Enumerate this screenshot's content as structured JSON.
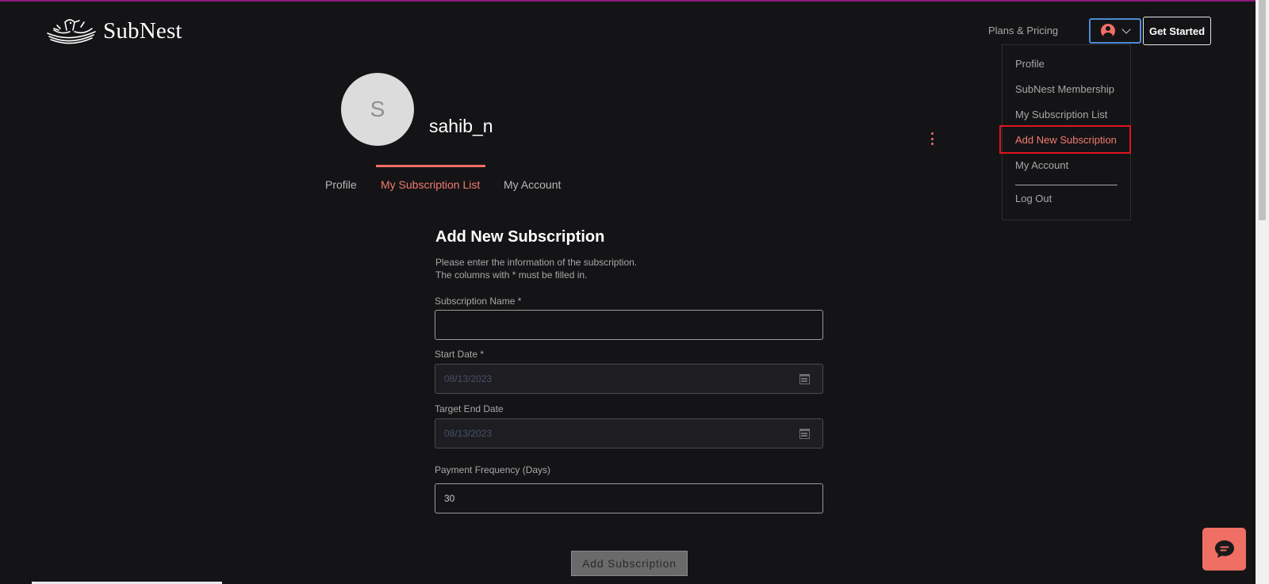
{
  "header": {
    "brand": "SubNest",
    "nav_plans": "Plans & Pricing",
    "get_started": "Get Started"
  },
  "user_menu": {
    "items": [
      {
        "label": "Profile"
      },
      {
        "label": "SubNest Membership"
      },
      {
        "label": "My Subscription List"
      },
      {
        "label": "Add New Subscription"
      },
      {
        "label": "My Account"
      },
      {
        "label": "Log Out"
      }
    ]
  },
  "profile": {
    "avatar_initial": "S",
    "username": "sahib_n"
  },
  "tabs": [
    {
      "label": "Profile"
    },
    {
      "label": "My Subscription List"
    },
    {
      "label": "My Account"
    }
  ],
  "form": {
    "title": "Add New Subscription",
    "desc_line1": "Please enter the information of the subscription.",
    "desc_line2": "The columns with * must be filled in.",
    "name_label": "Subscription Name *",
    "name_value": "",
    "start_label": "Start Date *",
    "start_value": "08/13/2023",
    "end_label": "Target End Date",
    "end_value": "08/13/2023",
    "freq_label": "Payment Frequency (Days)",
    "freq_value": "30",
    "submit": "Add Subscription"
  },
  "icons": {
    "user": "user-circle-icon",
    "chevron": "chevron-down-icon",
    "more": "more-vertical-icon",
    "calendar": "calendar-icon",
    "chat": "chat-icon"
  },
  "colors": {
    "background": "#141416",
    "accent": "#f06f65",
    "active_text": "#f47a70",
    "highlight_border": "#e0141e"
  }
}
